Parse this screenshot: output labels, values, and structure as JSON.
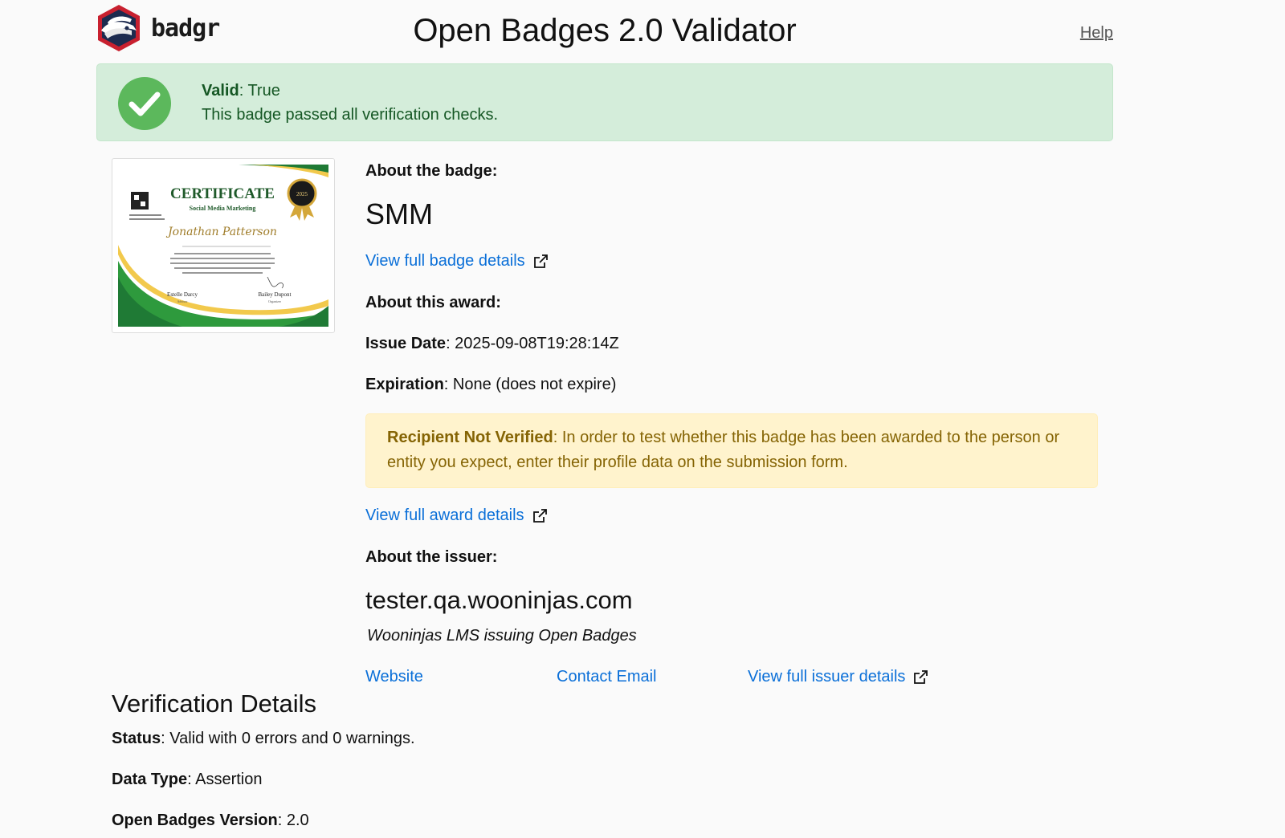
{
  "header": {
    "logo_text": "badgr",
    "title": "Open Badges 2.0 Validator",
    "help_label": "Help"
  },
  "validation": {
    "valid_label": "Valid",
    "valid_value": ": True",
    "message": "This badge passed all verification checks."
  },
  "certificate": {
    "heading": "CERTIFICATE",
    "subtitle": "Social Media Marketing",
    "recipient": "Jonathan Patterson",
    "year": "2025",
    "signer_left": "Estelle Darcy",
    "signer_left_role": "Advisor",
    "signer_right": "Bailey Dupont",
    "signer_right_role": "Organizer"
  },
  "badge": {
    "section_label": "About the badge:",
    "name": "SMM",
    "details_link": "View full badge details"
  },
  "award": {
    "section_label": "About this award:",
    "issue_date_label": "Issue Date",
    "issue_date_value": ": 2025-09-08T19:28:14Z",
    "expiration_label": "Expiration",
    "expiration_value": ": None (does not expire)",
    "details_link": "View full award details"
  },
  "recipient_warning": {
    "label": "Recipient Not Verified",
    "text": ": In order to test whether this badge has been awarded to the person or entity you expect, enter their profile data on the submission form."
  },
  "issuer": {
    "section_label": "About the issuer:",
    "name": "tester.qa.wooninjas.com",
    "description": "Wooninjas LMS issuing Open Badges",
    "website_link": "Website",
    "email_link": "Contact Email",
    "details_link": "View full issuer details"
  },
  "verification": {
    "title": "Verification Details",
    "status_label": "Status",
    "status_value": ": Valid with 0 errors and 0 warnings.",
    "data_type_label": "Data Type",
    "data_type_value": ": Assertion",
    "version_label": "Open Badges Version",
    "version_value": ": 2.0"
  },
  "colors": {
    "link": "#0a6fd8",
    "success_bg": "#d4edda",
    "success_text": "#155724",
    "warning_bg": "#fff3cd",
    "warning_text": "#856404",
    "check_green": "#5cb85c"
  },
  "icons": {
    "logo": "badger-shield-icon",
    "check": "check-circle-icon",
    "external": "external-link-icon"
  }
}
